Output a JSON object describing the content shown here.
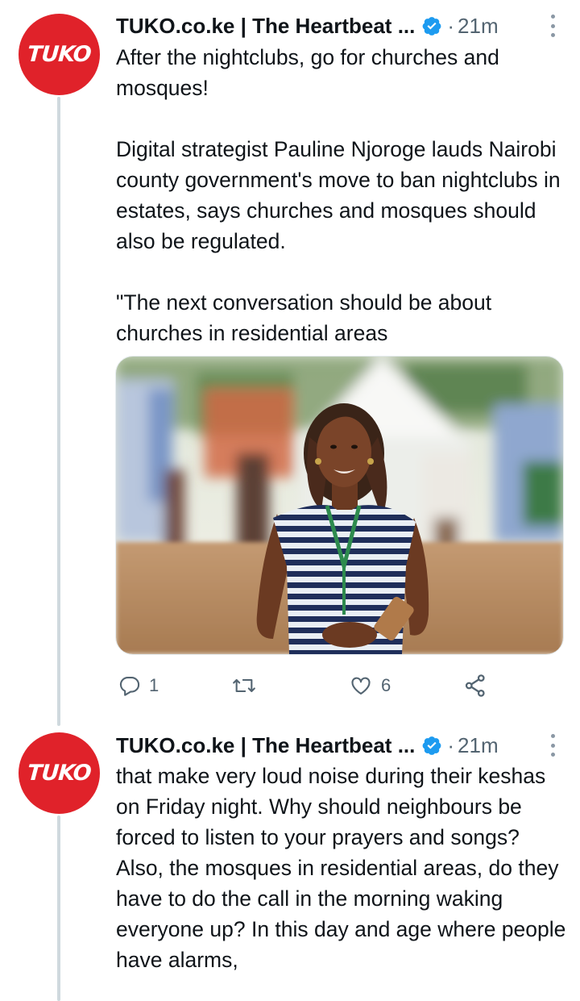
{
  "tweets": [
    {
      "avatar_logo": "TUKO",
      "author_name": "TUKO.co.ke | The Heartbeat ...",
      "verified_icon": "verified-badge-icon",
      "separator": "·",
      "time": "21m",
      "text": "After the nightclubs, go for churches and mosques!\n\nDigital strategist Pauline Njoroge lauds Nairobi county government's move to ban nightclubs in estates, says churches and mosques should also be regulated.\n\n\"The next conversation should be about churches in residential areas",
      "media": {
        "type": "photo",
        "colors": {
          "ground": "#b58a62",
          "sky": "#f2f4ef",
          "dress_stripe_dark": "#1f2e5a",
          "dress_stripe_light": "#e9eef4",
          "skin": "#6b3a22",
          "lanyard": "#2e8b4e"
        }
      },
      "actions": {
        "reply": {
          "icon": "reply-icon",
          "count": "1"
        },
        "retweet": {
          "icon": "retweet-icon",
          "count": ""
        },
        "like": {
          "icon": "heart-icon",
          "count": "6"
        },
        "share": {
          "icon": "share-icon",
          "count": ""
        }
      }
    },
    {
      "avatar_logo": "TUKO",
      "author_name": "TUKO.co.ke | The Heartbeat ...",
      "verified_icon": "verified-badge-icon",
      "separator": "·",
      "time": "21m",
      "text": "that make very loud noise during their keshas on Friday night. Why should neighbours be forced to listen to your prayers and songs? Also, the mosques in residential areas, do they have to do the call in the morning waking everyone up? In this day and age where people have alarms,"
    }
  ],
  "colors": {
    "brand_red": "#e0222a",
    "verified_blue": "#1d9bf0",
    "secondary_text": "#536471",
    "thread_line": "#cfd9de"
  }
}
